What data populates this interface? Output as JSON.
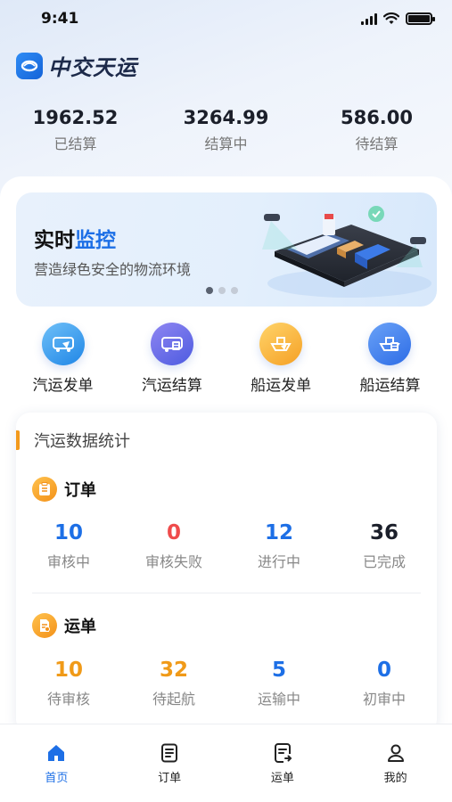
{
  "status_bar": {
    "time": "9:41"
  },
  "app": {
    "logo_text": "中交天运"
  },
  "summary": [
    {
      "value": "1962.52",
      "label": "已结算"
    },
    {
      "value": "3264.99",
      "label": "结算中"
    },
    {
      "value": "586.00",
      "label": "待结算"
    }
  ],
  "banner": {
    "title_plain": "实时",
    "title_highlight": "监控",
    "subtitle": "营造绿色安全的物流环境",
    "page_count": 3,
    "active_page": 1
  },
  "quick_actions": [
    {
      "label": "汽运发单",
      "icon": "truck-send-icon"
    },
    {
      "label": "汽运结算",
      "icon": "truck-settle-icon"
    },
    {
      "label": "船运发单",
      "icon": "ship-send-icon"
    },
    {
      "label": "船运结算",
      "icon": "ship-settle-icon"
    }
  ],
  "stats": {
    "section_title": "汽运数据统计",
    "orders": {
      "title": "订单",
      "metrics": [
        {
          "value": "10",
          "label": "审核中",
          "color": "#1d6fe6"
        },
        {
          "value": "0",
          "label": "审核失败",
          "color": "#ef4b4b"
        },
        {
          "value": "12",
          "label": "进行中",
          "color": "#1d6fe6"
        },
        {
          "value": "36",
          "label": "已完成",
          "color": "#1b1f2a"
        }
      ]
    },
    "waybills": {
      "title": "运单",
      "metrics": [
        {
          "value": "10",
          "label": "待审核",
          "color": "#f09a18"
        },
        {
          "value": "32",
          "label": "待起航",
          "color": "#f09a18"
        },
        {
          "value": "5",
          "label": "运输中",
          "color": "#1d6fe6"
        },
        {
          "value": "0",
          "label": "初审中",
          "color": "#1d6fe6"
        }
      ]
    }
  },
  "tabbar": [
    {
      "label": "首页",
      "icon": "home-icon",
      "active": true
    },
    {
      "label": "订单",
      "icon": "order-icon",
      "active": false
    },
    {
      "label": "运单",
      "icon": "waybill-icon",
      "active": false
    },
    {
      "label": "我的",
      "icon": "profile-icon",
      "active": false
    }
  ],
  "colors": {
    "primary": "#1d6fe6",
    "accent_orange": "#f39a1c",
    "danger": "#ef4b4b"
  }
}
